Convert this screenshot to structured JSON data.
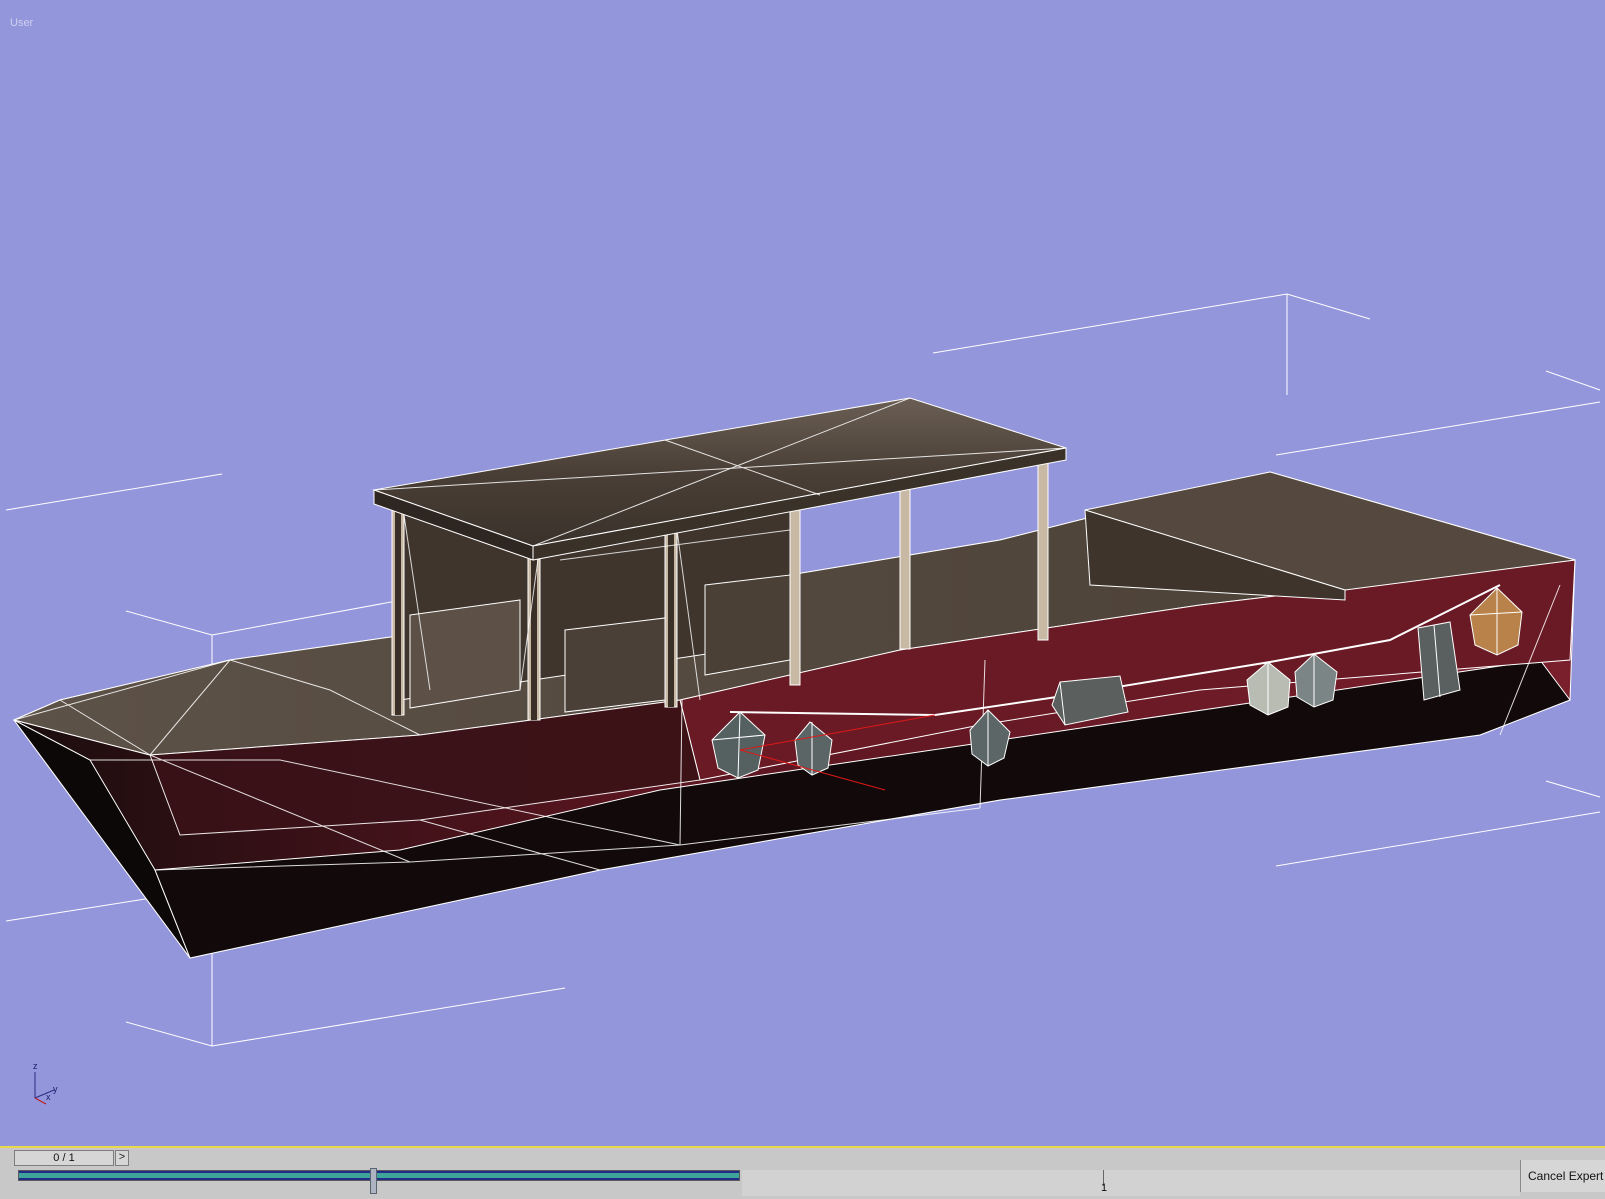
{
  "viewport": {
    "label": "User",
    "background_color": "#9496dc",
    "scene_object": "wooden-boat-model",
    "axis_tripod_labels": {
      "z": "z",
      "x": "x",
      "y": "y"
    }
  },
  "timeline": {
    "frame_counter": "0 / 1",
    "next_button_label": ">",
    "tick_label": "1",
    "accent_color": "#e9d84a"
  },
  "status": {
    "cancel_expert_mode_label": "Cancel Expert M"
  }
}
